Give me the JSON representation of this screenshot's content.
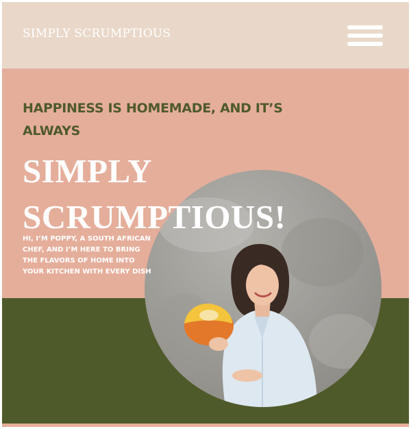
{
  "header": {
    "logo_text": "SIMPLY SCRUMPTIOUS",
    "menu_icon": "hamburger-menu-icon"
  },
  "hero": {
    "tagline": "HAPPINESS IS HOMEMADE, AND IT’S ALWAYS",
    "headline": "SIMPLY SCRUMPTIOUS!",
    "intro": "HI, I’M POPPY, A SOUTH AFRICAN CHEF, AND I’M HERE TO BRING THE FLAVORS OF HOME INTO YOUR KITCHEN WITH EVERY DISH"
  },
  "colors": {
    "header_bg": "#e9d8c9",
    "hero_bg": "#e5ae9b",
    "accent_green": "#4f5a2a",
    "text_light": "#ffffff"
  }
}
